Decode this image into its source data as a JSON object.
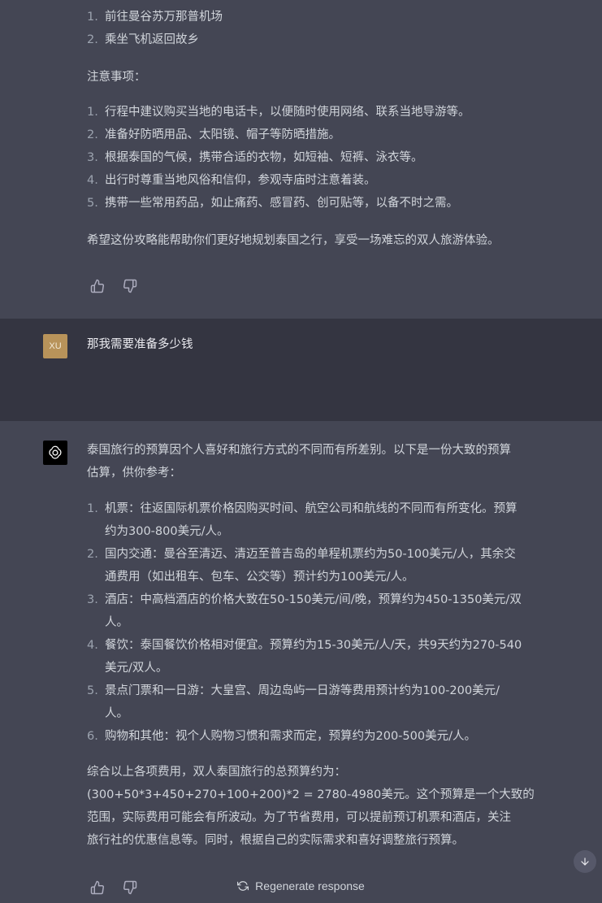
{
  "ai_prev": {
    "steps_top": [
      {
        "num": "1.",
        "text": "前往曼谷苏万那普机场"
      },
      {
        "num": "2.",
        "text": "乘坐飞机返回故乡"
      }
    ],
    "notes_title": "注意事项：",
    "notes": [
      {
        "num": "1.",
        "text": "行程中建议购买当地的电话卡，以便随时使用网络、联系当地导游等。"
      },
      {
        "num": "2.",
        "text": "准备好防晒用品、太阳镜、帽子等防晒措施。"
      },
      {
        "num": "3.",
        "text": "根据泰国的气候，携带合适的衣物，如短袖、短裤、泳衣等。"
      },
      {
        "num": "4.",
        "text": "出行时尊重当地风俗和信仰，参观寺庙时注意着装。"
      },
      {
        "num": "5.",
        "text": "携带一些常用药品，如止痛药、感冒药、创可贴等，以备不时之需。"
      }
    ],
    "closing": "希望这份攻略能帮助你们更好地规划泰国之行，享受一场难忘的双人旅游体验。"
  },
  "user": {
    "avatar_initials": "XU",
    "message": "那我需要准备多少钱"
  },
  "ai_reply": {
    "intro_line1": "泰国旅行的预算因个人喜好和旅行方式的不同而有所差别。以下是一份大致的预算",
    "intro_line2": "估算，供你参考：",
    "items": [
      {
        "num": "1.",
        "line1": "机票：往返国际机票价格因购买时间、航空公司和航线的不同而有所变化。预算",
        "line2": "约为300-800美元/人。"
      },
      {
        "num": "2.",
        "line1": "国内交通：曼谷至清迈、清迈至普吉岛的单程机票约为50-100美元/人，其余交",
        "line2": "通费用（如出租车、包车、公交等）预计约为100美元/人。"
      },
      {
        "num": "3.",
        "line1": "酒店：中高档酒店的价格大致在50-150美元/间/晚，预算约为450-1350美元/双",
        "line2": "人。"
      },
      {
        "num": "4.",
        "line1": "餐饮：泰国餐饮价格相对便宜。预算约为15-30美元/人/天，共9天约为270-540",
        "line2": "美元/双人。"
      },
      {
        "num": "5.",
        "line1": "景点门票和一日游：大皇宫、周边岛屿一日游等费用预计约为100-200美元/",
        "line2": "人。"
      },
      {
        "num": "6.",
        "line1": "购物和其他：视个人购物习惯和需求而定，预算约为200-500美元/人。",
        "line2": ""
      }
    ],
    "summary_line1": "综合以上各项费用，双人泰国旅行的总预算约为：",
    "summary_line2": "(300+50*3+450+270+100+200)*2 = 2780-4980美元。这个预算是一个大致的",
    "summary_line3": "范围，实际费用可能会有所波动。为了节省费用，可以提前预订机票和酒店，关注",
    "summary_line4": "旅行社的优惠信息等。同时，根据自己的实际需求和喜好调整旅行预算。"
  },
  "footer": {
    "regenerate_label": "Regenerate response"
  },
  "icons": {
    "thumbs_up": "thumbs-up-icon",
    "thumbs_down": "thumbs-down-icon",
    "openai": "openai-logo-icon",
    "refresh": "refresh-icon",
    "arrow_down": "arrow-down-icon"
  },
  "colors": {
    "ai_bg": "#444654",
    "user_bg": "#343541",
    "user_avatar": "#b8935a",
    "text": "#d1d5db"
  }
}
